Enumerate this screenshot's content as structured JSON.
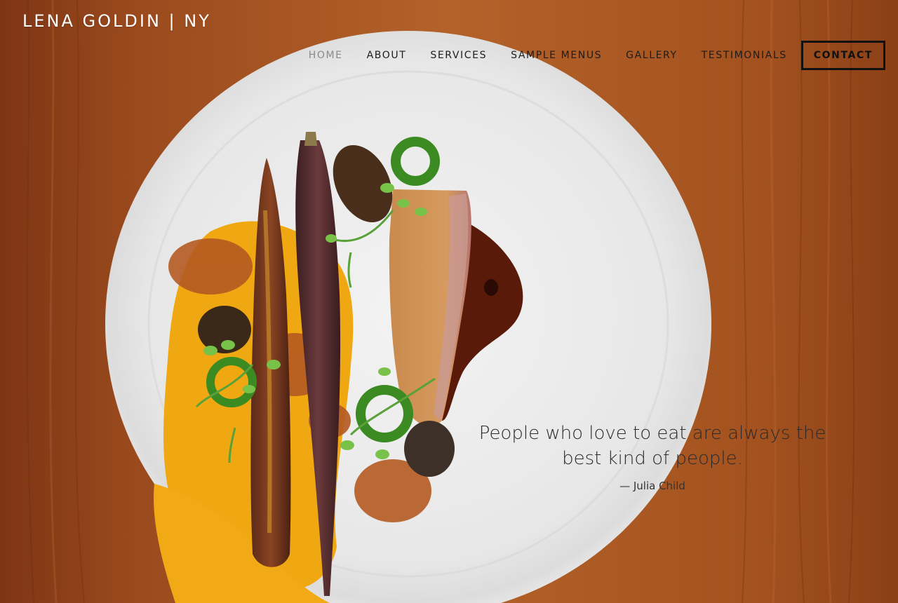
{
  "brand": {
    "name": "LENA GOLDIN | NY"
  },
  "nav": {
    "items": [
      {
        "label": "HOME",
        "active": true
      },
      {
        "label": "ABOUT",
        "active": false
      },
      {
        "label": "SERVICES",
        "active": false
      },
      {
        "label": "SAMPLE MENUS",
        "active": false
      },
      {
        "label": "GALLERY",
        "active": false
      },
      {
        "label": "TESTIMONIALS",
        "active": false
      }
    ],
    "contact": "CONTACT"
  },
  "hero": {
    "quote": "People who love to eat are always the best kind of people.",
    "author": "— Julia Child"
  },
  "colors": {
    "wood": "#a9561f",
    "plate": "#ececec",
    "nav_text": "#1c1c1c",
    "nav_active": "#8a8a8a",
    "brand_text": "#ffffff"
  }
}
